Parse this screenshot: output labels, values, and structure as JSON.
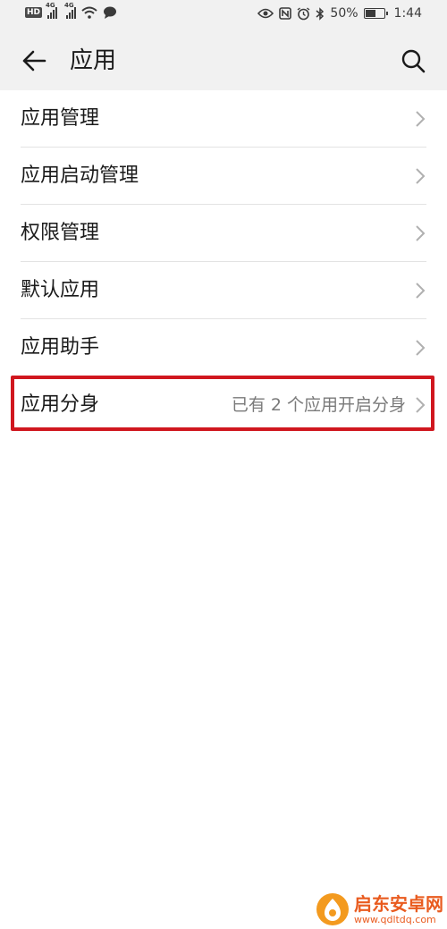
{
  "status_bar": {
    "hd": "HD",
    "net1": "4G",
    "net2": "4G",
    "battery_text": "50%",
    "battery_level": 0.5,
    "time": "1:44"
  },
  "header": {
    "title": "应用",
    "back_icon": "arrow-left-icon",
    "search_icon": "search-icon"
  },
  "menu": {
    "items": [
      {
        "label": "应用管理",
        "value": ""
      },
      {
        "label": "应用启动管理",
        "value": ""
      },
      {
        "label": "权限管理",
        "value": ""
      },
      {
        "label": "默认应用",
        "value": ""
      },
      {
        "label": "应用助手",
        "value": ""
      },
      {
        "label": "应用分身",
        "value": "已有 2 个应用开启分身"
      }
    ]
  },
  "highlight_color": "#d0171f",
  "watermark": {
    "name": "启东安卓网",
    "url": "www.qdltdq.com"
  }
}
